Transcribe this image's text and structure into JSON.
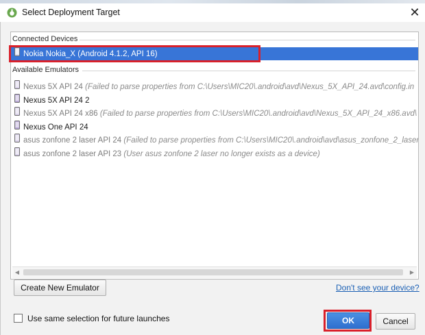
{
  "window": {
    "title": "Select Deployment Target",
    "close_glyph": "✕",
    "icon": "android-studio-icon"
  },
  "colors": {
    "selection": "#3875d7",
    "highlight_box": "#d9202a",
    "link": "#1a5fb4"
  },
  "connected_devices": {
    "header": "Connected Devices",
    "items": [
      {
        "name": "Nokia Nokia_X (Android 4.1.2, API 16)",
        "note": "",
        "selected": true
      }
    ]
  },
  "available_emulators": {
    "header": "Available Emulators",
    "items": [
      {
        "name": "Nexus 5X API 24",
        "note": "(Failed to parse properties from C:\\Users\\MIC20\\.android\\avd\\Nexus_5X_API_24.avd\\config.in",
        "dim": true
      },
      {
        "name": "Nexus 5X API 24 2",
        "note": "",
        "dim": false
      },
      {
        "name": "Nexus 5X API 24 x86",
        "note": "(Failed to parse properties from C:\\Users\\MIC20\\.android\\avd\\Nexus_5X_API_24_x86.avd\\",
        "dim": true
      },
      {
        "name": "Nexus One API 24",
        "note": "",
        "dim": false
      },
      {
        "name": "asus zonfone 2 laser API 24",
        "note": "(Failed to parse properties from C:\\Users\\MIC20\\.android\\avd\\asus_zonfone_2_laser",
        "dim": true
      },
      {
        "name": "asus zonfone 2 laser API 23",
        "note": "(User asus zonfone 2 laser no longer exists as a device)",
        "dim": true
      }
    ]
  },
  "buttons": {
    "create_new_emulator": "Create New Emulator",
    "ok": "OK",
    "cancel": "Cancel"
  },
  "links": {
    "dont_see_device": "Don't see your device?"
  },
  "checkbox": {
    "label": "Use same selection for future launches",
    "checked": false
  }
}
